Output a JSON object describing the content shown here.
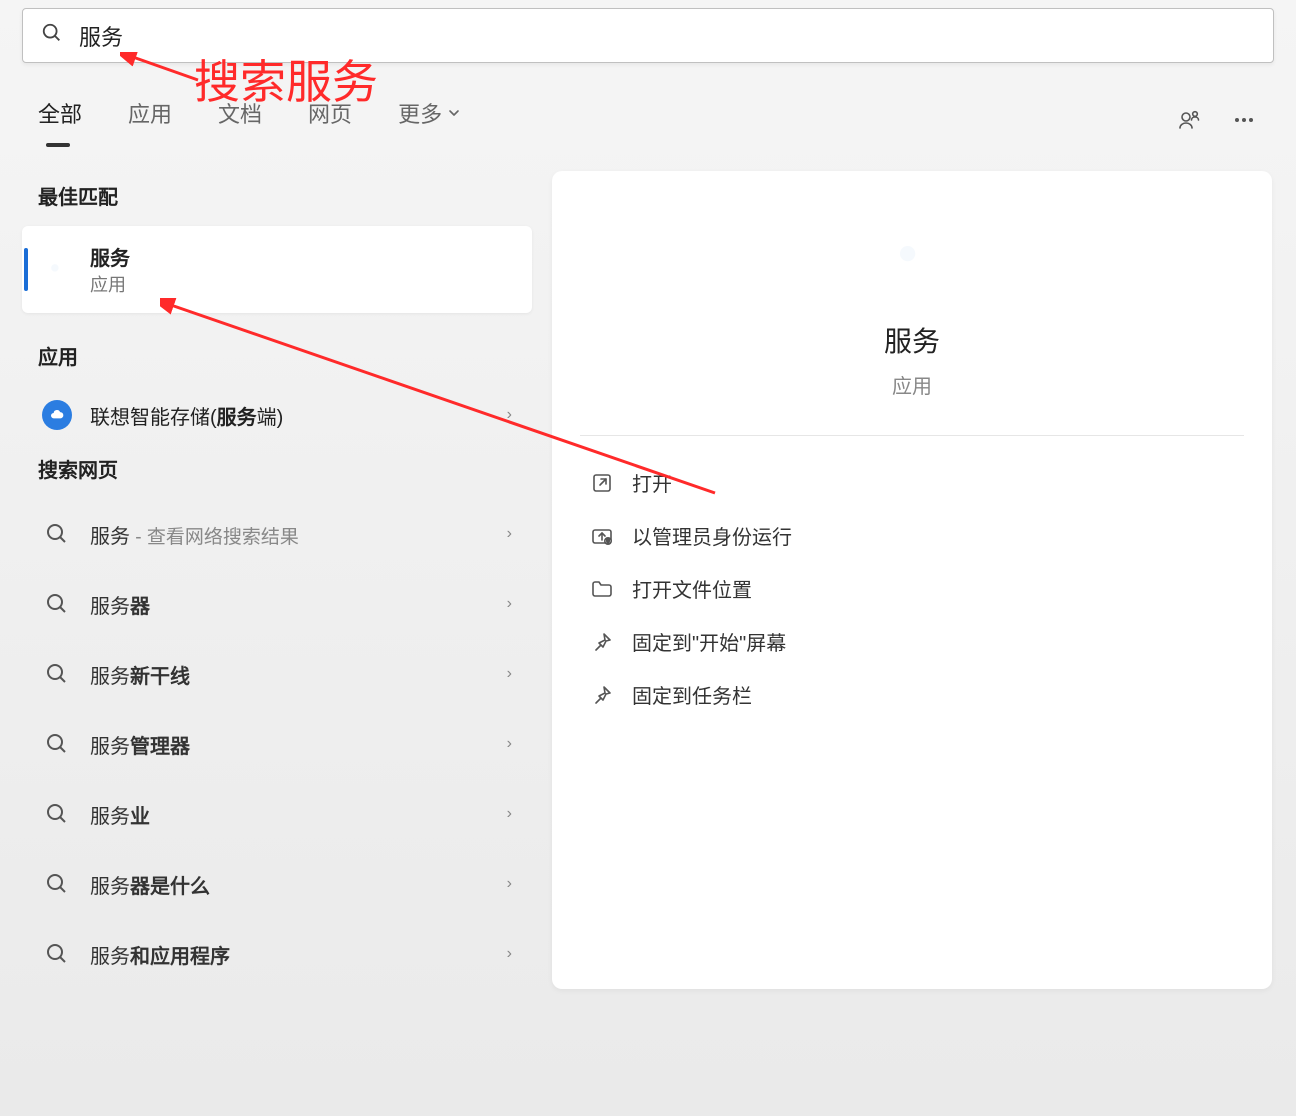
{
  "search": {
    "query": "服务"
  },
  "annotation": {
    "label": "搜索服务"
  },
  "tabs": {
    "all": "全部",
    "apps": "应用",
    "docs": "文档",
    "web": "网页",
    "more": "更多"
  },
  "left": {
    "best_match_header": "最佳匹配",
    "best_match": {
      "title": "服务",
      "subtitle": "应用"
    },
    "apps_header": "应用",
    "app_item": {
      "prefix": "联想智能存储(",
      "bold": "服务",
      "suffix": "端)"
    },
    "web_header": "搜索网页",
    "web_items": [
      {
        "prefix": "服务",
        "bold": "",
        "suffix": " - 查看网络搜索结果"
      },
      {
        "prefix": "服务",
        "bold": "器",
        "suffix": ""
      },
      {
        "prefix": "服务",
        "bold": "新干线",
        "suffix": ""
      },
      {
        "prefix": "服务",
        "bold": "管理器",
        "suffix": ""
      },
      {
        "prefix": "服务",
        "bold": "业",
        "suffix": ""
      },
      {
        "prefix": "服务",
        "bold": "器是什么",
        "suffix": ""
      },
      {
        "prefix": "服务",
        "bold": "和应用程序",
        "suffix": ""
      }
    ]
  },
  "preview": {
    "title": "服务",
    "subtitle": "应用",
    "actions": {
      "open": "打开",
      "run_admin": "以管理员身份运行",
      "open_location": "打开文件位置",
      "pin_start": "固定到\"开始\"屏幕",
      "pin_taskbar": "固定到任务栏"
    }
  }
}
